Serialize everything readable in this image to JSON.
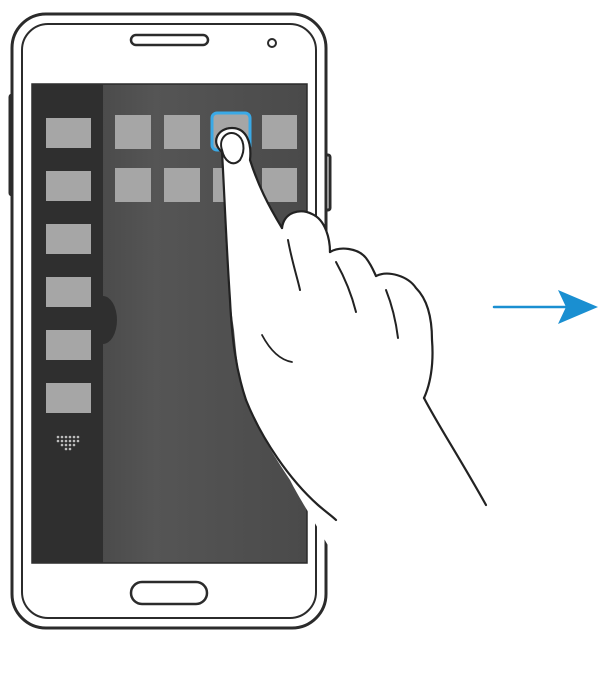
{
  "illustration": {
    "description_icons": {
      "device": "smartphone-icon",
      "gesture": "hand-pointer-icon",
      "direction": "arrow-right-icon"
    }
  },
  "multi_window_tray": {
    "app_slots": [
      "app-slot-1",
      "app-slot-2",
      "app-slot-3",
      "app-slot-4",
      "app-slot-5",
      "app-slot-6"
    ],
    "grid_icon": "grid-dots-icon"
  },
  "main_area": {
    "app_grid_rows": 2,
    "app_grid_cols": 4,
    "selected_slot": "row-1-col-3"
  },
  "colors": {
    "accent": "#1a8fd1",
    "highlight": "#3aa9e6",
    "tray_bg": "#2f2f2f",
    "screen_bg": "#4d4d4d",
    "tile": "#a6a6a6",
    "phone_outline": "#2b2b2b"
  }
}
